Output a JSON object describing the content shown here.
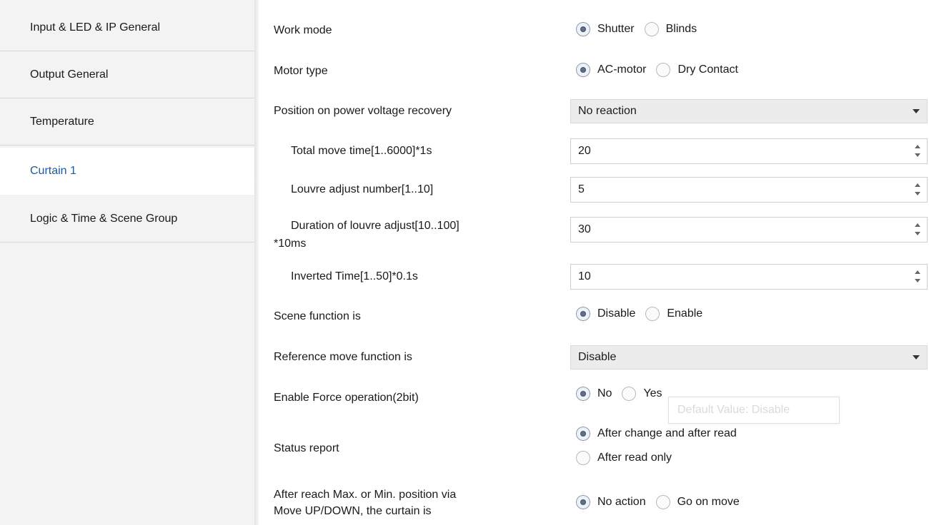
{
  "sidebar": {
    "items": [
      {
        "label": "Input & LED & IP General"
      },
      {
        "label": "Output General"
      },
      {
        "label": "Temperature"
      },
      {
        "label": "Curtain 1"
      },
      {
        "label": "Logic & Time & Scene Group"
      }
    ],
    "active_index": 3
  },
  "params": {
    "work_mode": {
      "label": "Work mode",
      "options": [
        "Shutter",
        "Blinds"
      ],
      "selected": "Shutter"
    },
    "motor_type": {
      "label": "Motor type",
      "options": [
        "AC-motor",
        "Dry Contact"
      ],
      "selected": "AC-motor"
    },
    "position_recovery": {
      "label": "Position on power voltage recovery",
      "value": "No reaction"
    },
    "total_move_time": {
      "label": "Total move time[1..6000]*1s",
      "value": "20"
    },
    "louvre_adjust_number": {
      "label": "Louvre adjust number[1..10]",
      "value": "5"
    },
    "louvre_duration": {
      "label_line1": "Duration of louvre adjust[10..100]",
      "label_line2": "*10ms",
      "value": "30"
    },
    "inverted_time": {
      "label": "Inverted Time[1..50]*0.1s",
      "value": "10"
    },
    "scene_function": {
      "label": "Scene function is",
      "options": [
        "Disable",
        "Enable"
      ],
      "selected": "Disable"
    },
    "reference_move": {
      "label": "Reference move function is",
      "value": "Disable"
    },
    "force_operation": {
      "label": "Enable Force operation(2bit)",
      "options": [
        "No",
        "Yes"
      ],
      "selected": "No"
    },
    "status_report": {
      "label": "Status report",
      "options": [
        "After change and after read",
        "After read only"
      ],
      "selected": "After change and after read"
    },
    "reach_limit": {
      "label_line1": "After reach Max. or Min. position via",
      "label_line2": "Move UP/DOWN, the curtain is",
      "options": [
        "No action",
        "Go on move"
      ],
      "selected": "No action"
    }
  },
  "tooltip": {
    "text": "Default Value: Disable"
  },
  "colors": {
    "active_nav": "#1c5aa8",
    "sidebar_bg": "#f3f3f3",
    "dropdown_bg": "#ececec"
  }
}
